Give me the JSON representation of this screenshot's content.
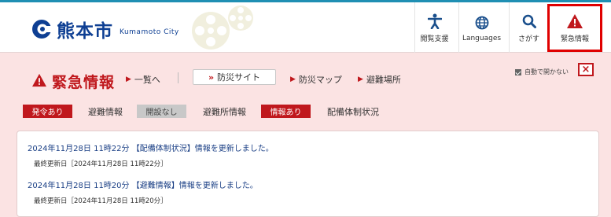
{
  "header": {
    "logo_name": "熊本市",
    "logo_sub": "Kumamoto City",
    "nav": [
      {
        "label": "閲覧支援",
        "icon": "accessibility-icon"
      },
      {
        "label": "Languages",
        "icon": "globe-icon"
      },
      {
        "label": "さがす",
        "icon": "search-icon"
      },
      {
        "label": "緊急情報",
        "icon": "warning-icon"
      }
    ]
  },
  "emergency": {
    "title": "緊急情報",
    "links": {
      "list": "一覧へ",
      "bosai_site": "防災サイト",
      "bosai_map": "防災マップ",
      "shelters": "避難場所"
    },
    "auto_open": "自動で開かない",
    "close": "×",
    "status": [
      {
        "badge": "発令あり",
        "label": "避難情報",
        "badge_color": "#c0181d"
      },
      {
        "badge": "開設なし",
        "label": "避難所情報",
        "badge_color": "#c8c8c8"
      },
      {
        "badge": "情報あり",
        "label": "配備体制状況",
        "badge_color": "#c0181d"
      }
    ],
    "news": [
      {
        "headline": "2024年11月28日 11時22分 【配備体制状況】情報を更新しました。",
        "updated": "最終更新日［2024年11月28日 11時22分］"
      },
      {
        "headline": "2024年11月28日 11時20分 【避難情報】情報を更新しました。",
        "updated": "最終更新日［2024年11月28日 11時20分］"
      }
    ]
  }
}
